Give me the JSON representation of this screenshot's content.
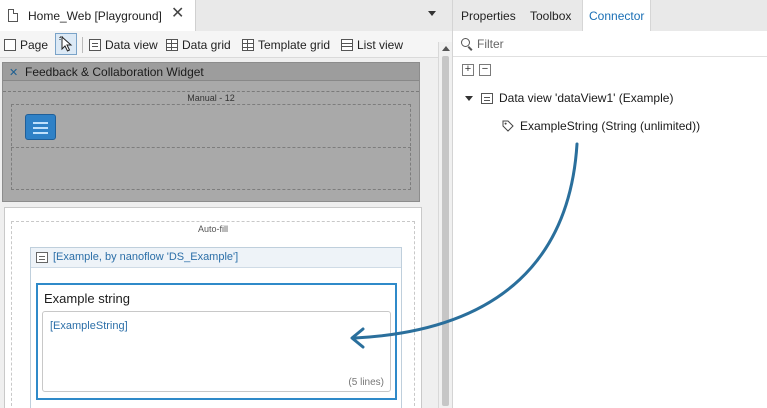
{
  "document_tab": {
    "title": "Home_Web [Playground]",
    "close": "✕"
  },
  "toolbar": {
    "page": "Page",
    "data_view": "Data view",
    "data_grid": "Data grid",
    "template_grid": "Template grid",
    "list_view": "List view"
  },
  "canvas": {
    "snippet_title": "Feedback & Collaboration Widget",
    "manual_label": "Manual - 12",
    "autofill_label": "Auto-fill",
    "dataview_title": "[Example, by nanoflow 'DS_Example']",
    "textbox_label": "Example string",
    "textbox_value": "[ExampleString]",
    "textbox_lines": "(5 lines)"
  },
  "right_panel": {
    "tabs": [
      "Properties",
      "Toolbox",
      "Connector"
    ],
    "active_tab": "Connector",
    "filter_placeholder": "Filter",
    "expand_all": "+",
    "collapse_all": "−",
    "tree": {
      "dataview_node": "Data view 'dataView1' (Example)",
      "attribute_node": "ExampleString (String (unlimited))"
    }
  },
  "colors": {
    "accent": "#1a6fb5",
    "arrow": "#2a6f9c",
    "selection": "#2f8ac9"
  },
  "icons": [
    "page-icon",
    "pointer-icon",
    "data-view-icon",
    "data-grid-icon",
    "template-grid-icon",
    "list-view-icon",
    "search-icon",
    "tag-icon",
    "close-icon"
  ]
}
